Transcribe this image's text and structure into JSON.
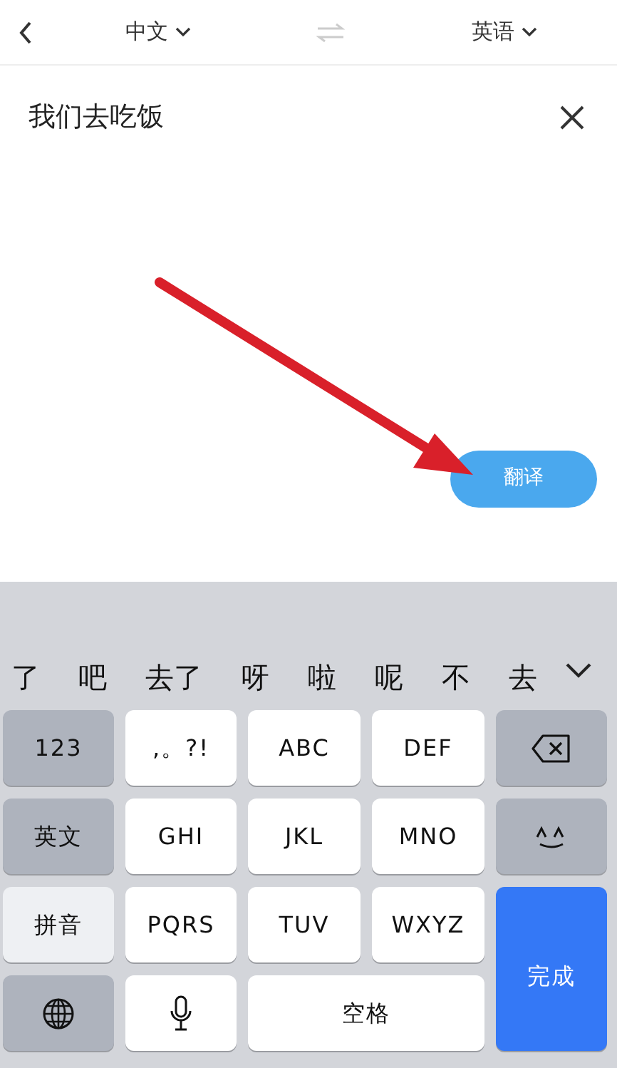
{
  "header": {
    "source_language": "中文",
    "target_language": "英语"
  },
  "input": {
    "value": "我们去吃饭"
  },
  "translate_button": "翻译",
  "candidates": [
    "了",
    "吧",
    "去了",
    "呀",
    "啦",
    "呢",
    "不",
    "去"
  ],
  "keys": [
    {
      "kind": "function",
      "label": "123"
    },
    {
      "kind": "char",
      "label": ",。?!"
    },
    {
      "kind": "char",
      "label": "ABC"
    },
    {
      "kind": "char",
      "label": "DEF"
    },
    {
      "kind": "backspace"
    },
    {
      "kind": "function",
      "label": "英文"
    },
    {
      "kind": "char",
      "label": "GHI"
    },
    {
      "kind": "char",
      "label": "JKL"
    },
    {
      "kind": "char",
      "label": "MNO"
    },
    {
      "kind": "emoticon"
    },
    {
      "kind": "active",
      "label": "拼音"
    },
    {
      "kind": "char",
      "label": "PQRS"
    },
    {
      "kind": "char",
      "label": "TUV"
    },
    {
      "kind": "char",
      "label": "WXYZ"
    },
    {
      "kind": "done",
      "label": "完成"
    },
    {
      "kind": "globe"
    },
    {
      "kind": "mic"
    },
    {
      "kind": "space",
      "label": "空格"
    }
  ]
}
